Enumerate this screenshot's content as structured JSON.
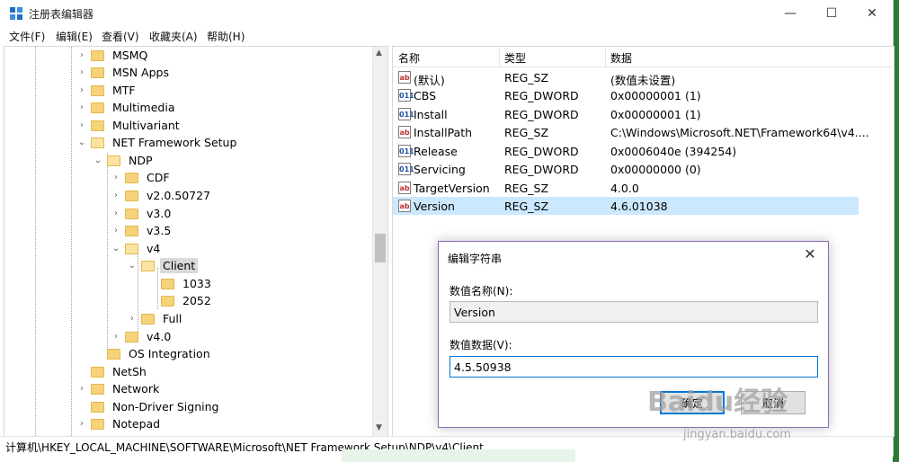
{
  "window": {
    "title": "注册表编辑器"
  },
  "titlebar_buttons": {
    "minimize": "—",
    "maximize": "☐",
    "close": "✕"
  },
  "menu": [
    "文件(F)",
    "编辑(E)",
    "查看(V)",
    "收藏夹(A)",
    "帮助(H)"
  ],
  "tree": [
    {
      "label": "MSMQ",
      "expander": "›"
    },
    {
      "label": "MSN Apps",
      "expander": "›"
    },
    {
      "label": "MTF",
      "expander": "›"
    },
    {
      "label": "Multimedia",
      "expander": "›"
    },
    {
      "label": "Multivariant",
      "expander": "›"
    },
    {
      "label": "NET Framework Setup",
      "expander": "⌄"
    },
    {
      "label": "NDP",
      "expander": "⌄"
    },
    {
      "label": "CDF",
      "expander": "›"
    },
    {
      "label": "v2.0.50727",
      "expander": "›"
    },
    {
      "label": "v3.0",
      "expander": "›"
    },
    {
      "label": "v3.5",
      "expander": "›"
    },
    {
      "label": "v4",
      "expander": "⌄"
    },
    {
      "label": "Client",
      "expander": "⌄"
    },
    {
      "label": "1033",
      "expander": ""
    },
    {
      "label": "2052",
      "expander": ""
    },
    {
      "label": "Full",
      "expander": "›"
    },
    {
      "label": "v4.0",
      "expander": "›"
    },
    {
      "label": "OS Integration",
      "expander": ""
    },
    {
      "label": "NetSh",
      "expander": ""
    },
    {
      "label": "Network",
      "expander": "›"
    },
    {
      "label": "Non-Driver Signing",
      "expander": ""
    },
    {
      "label": "Notepad",
      "expander": "›"
    }
  ],
  "list": {
    "headers": {
      "name": "名称",
      "type": "类型",
      "data": "数据"
    },
    "rows": [
      {
        "icon": "ab",
        "name": "(默认)",
        "type": "REG_SZ",
        "data": "(数值未设置)"
      },
      {
        "icon": "011",
        "name": "CBS",
        "type": "REG_DWORD",
        "data": "0x00000001 (1)"
      },
      {
        "icon": "011",
        "name": "Install",
        "type": "REG_DWORD",
        "data": "0x00000001 (1)"
      },
      {
        "icon": "ab",
        "name": "InstallPath",
        "type": "REG_SZ",
        "data": "C:\\Windows\\Microsoft.NET\\Framework64\\v4...."
      },
      {
        "icon": "011",
        "name": "Release",
        "type": "REG_DWORD",
        "data": "0x0006040e (394254)"
      },
      {
        "icon": "011",
        "name": "Servicing",
        "type": "REG_DWORD",
        "data": "0x00000000 (0)"
      },
      {
        "icon": "ab",
        "name": "TargetVersion",
        "type": "REG_SZ",
        "data": "4.0.0"
      },
      {
        "icon": "ab",
        "name": "Version",
        "type": "REG_SZ",
        "data": "4.6.01038"
      }
    ]
  },
  "status": "计算机\\HKEY_LOCAL_MACHINE\\SOFTWARE\\Microsoft\\NET Framework Setup\\NDP\\v4\\Client",
  "dialog": {
    "title": "编辑字符串",
    "close": "✕",
    "name_label": "数值名称(N):",
    "name_value": "Version",
    "data_label": "数值数据(V):",
    "data_value": "4.5.50938",
    "ok": "确定",
    "cancel": "取消"
  },
  "watermark": {
    "text": "Baidu经验",
    "url": "jingyan.baidu.com"
  }
}
